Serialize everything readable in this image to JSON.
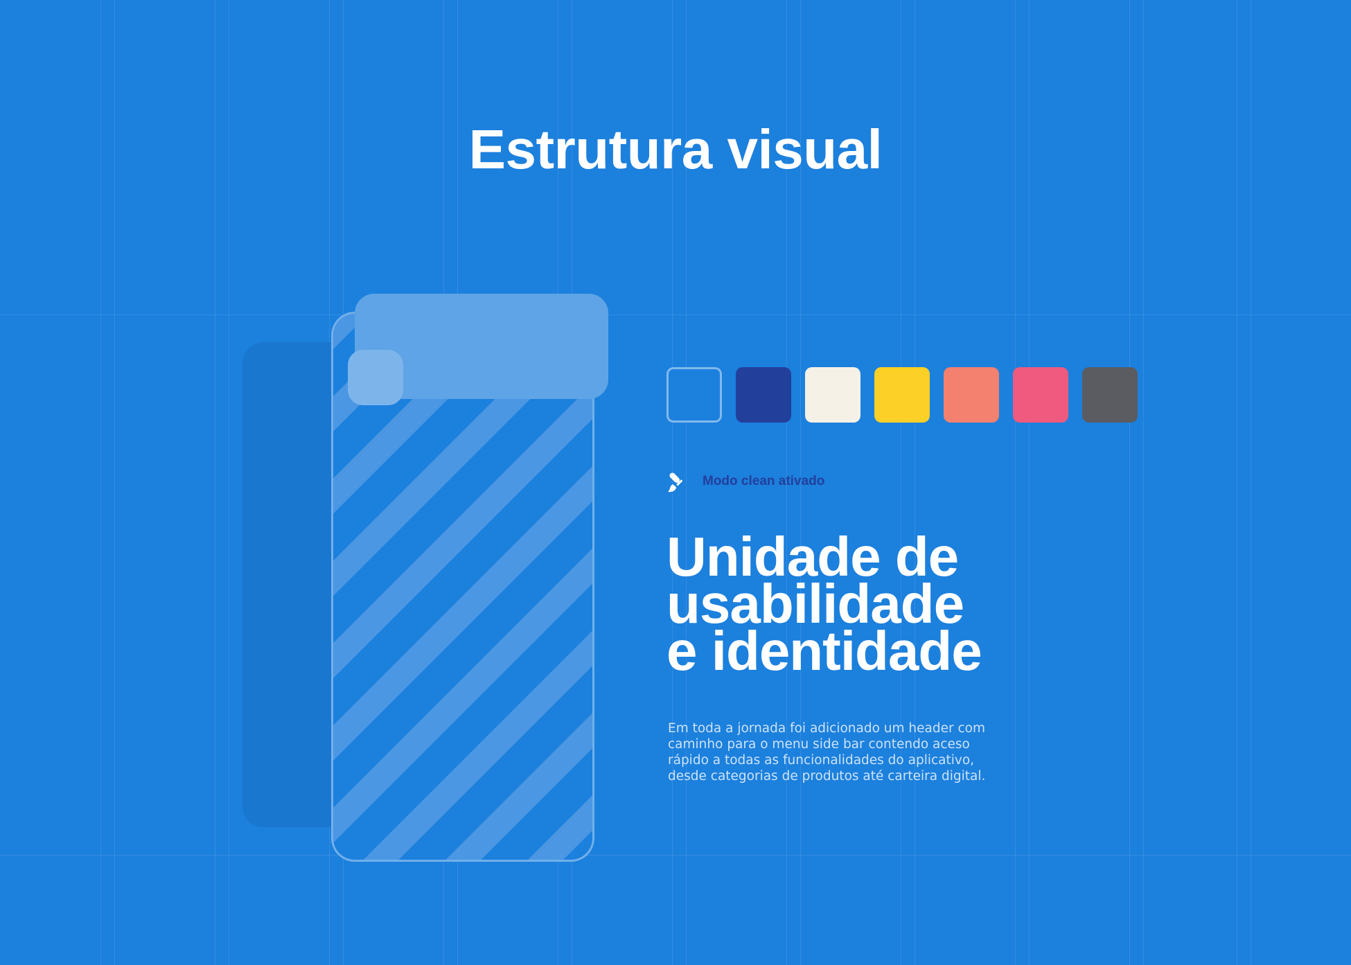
{
  "page": {
    "title": "Estrutura visual",
    "background_color": "#1c80dd"
  },
  "mockup": {
    "frame_icon": "phone-wireframe",
    "header_color": "#5ea4e6",
    "stripe_color": "#4b97e4"
  },
  "palette": {
    "colors": [
      "#1c80dd",
      "#233f9c",
      "#f5f1e6",
      "#fcd026",
      "#f4806f",
      "#f05a7e",
      "#5a5c61"
    ]
  },
  "mode": {
    "icon": "paintbrush-icon",
    "label": "Modo clean ativado"
  },
  "headline": {
    "lines": [
      "Unidade de",
      "usabilidade",
      "e identidade"
    ]
  },
  "description": "Em toda a jornada foi adicionado um header com caminho para o menu side bar contendo aceso rápido a todas as funcionalidades do aplicativo, desde categorias de produtos até carteira digital."
}
